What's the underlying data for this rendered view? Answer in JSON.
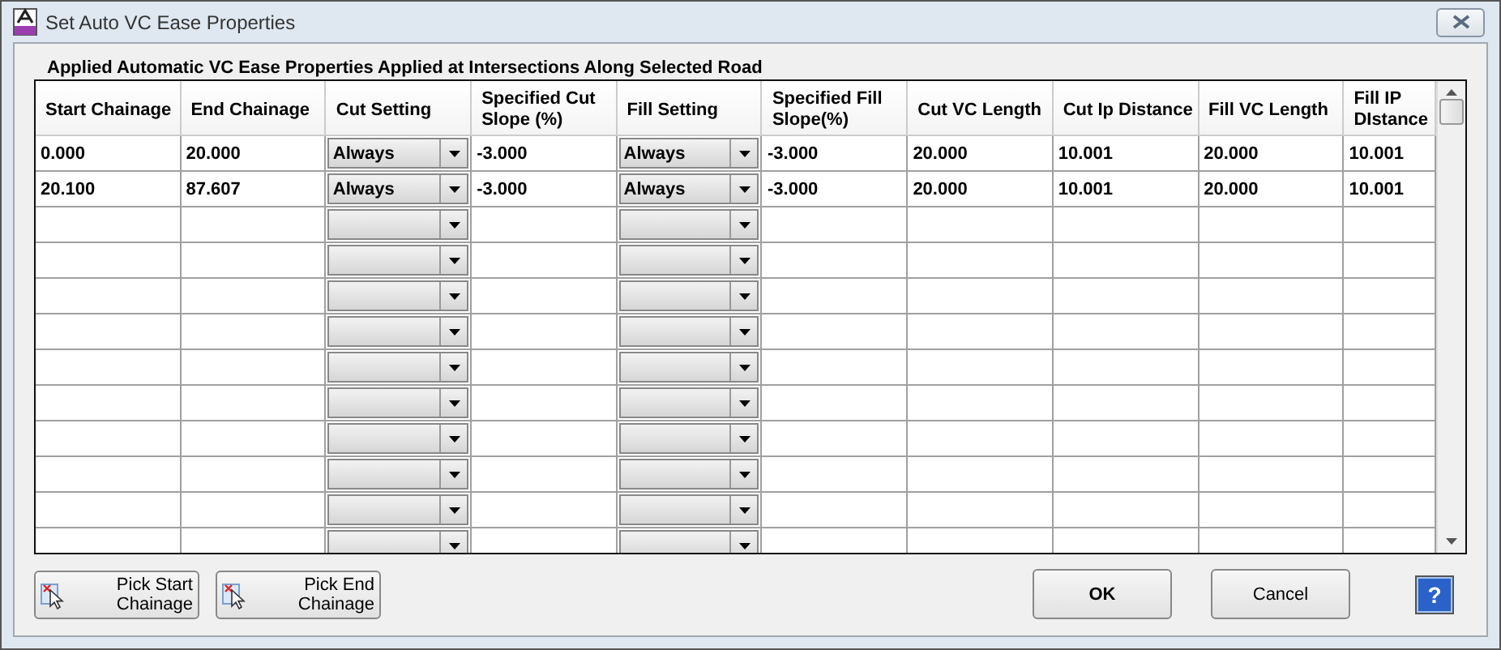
{
  "window": {
    "title": "Set Auto VC Ease Properties"
  },
  "group": {
    "label": "Applied Automatic VC Ease Properties Applied at Intersections Along Selected Road"
  },
  "table": {
    "columns": [
      {
        "label": "Start Chainage",
        "kind": "text"
      },
      {
        "label": "End Chainage",
        "kind": "text"
      },
      {
        "label": "Cut Setting",
        "kind": "dropdown"
      },
      {
        "label": "Specified Cut Slope (%)",
        "kind": "text"
      },
      {
        "label": "Fill Setting",
        "kind": "dropdown"
      },
      {
        "label": "Specified Fill Slope(%)",
        "kind": "text"
      },
      {
        "label": "Cut VC Length",
        "kind": "text"
      },
      {
        "label": "Cut Ip Distance",
        "kind": "text"
      },
      {
        "label": "Fill VC Length",
        "kind": "text"
      },
      {
        "label": "Fill IP DIstance",
        "kind": "text"
      }
    ],
    "rows": [
      {
        "cells": [
          "0.000",
          "20.000",
          "Always",
          "-3.000",
          "Always",
          "-3.000",
          "20.000",
          "10.001",
          "20.000",
          "10.001"
        ]
      },
      {
        "cells": [
          "20.100",
          "87.607",
          "Always",
          "-3.000",
          "Always",
          "-3.000",
          "20.000",
          "10.001",
          "20.000",
          "10.001"
        ]
      },
      {
        "cells": []
      },
      {
        "cells": []
      },
      {
        "cells": []
      },
      {
        "cells": []
      },
      {
        "cells": []
      },
      {
        "cells": []
      },
      {
        "cells": []
      },
      {
        "cells": []
      },
      {
        "cells": []
      },
      {
        "cells": []
      }
    ]
  },
  "buttons": [
    {
      "label": "Pick Start Chainage",
      "kind": "pick"
    },
    {
      "label": "Pick End Chainage",
      "kind": "pick"
    },
    {
      "label": "OK",
      "kind": "ok"
    },
    {
      "label": "Cancel",
      "kind": "cancel"
    },
    {
      "label": "?",
      "kind": "help"
    }
  ]
}
